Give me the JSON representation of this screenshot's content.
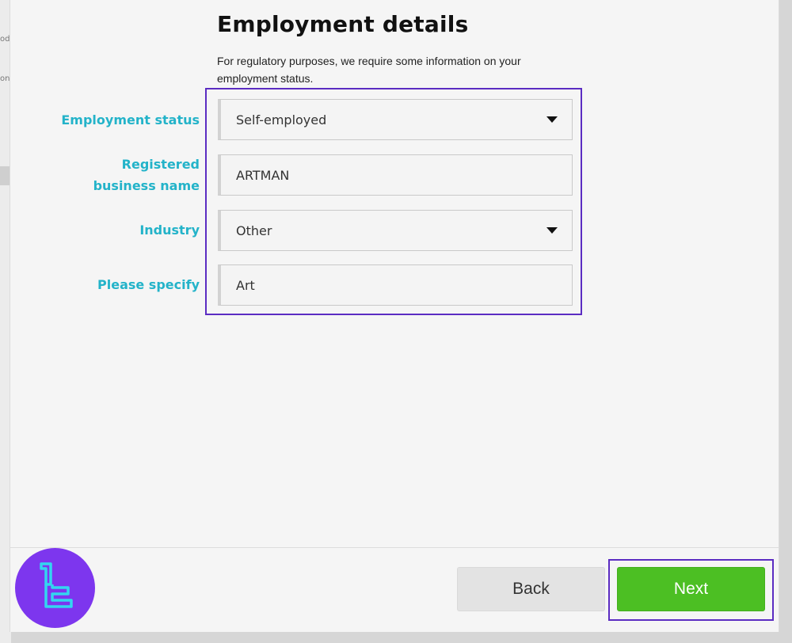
{
  "background": {
    "fragments": [
      "od",
      "onf"
    ]
  },
  "form": {
    "title": "Employment details",
    "subtitle": "For regulatory purposes, we require some information on your employment status.",
    "fields": [
      {
        "label": "Employment status",
        "type": "select",
        "value": "Self-employed"
      },
      {
        "label": "Registered business name",
        "type": "text",
        "value": "ARTMAN"
      },
      {
        "label": "Industry",
        "type": "select",
        "value": "Other"
      },
      {
        "label": "Please specify",
        "type": "text",
        "value": "Art"
      }
    ]
  },
  "footer": {
    "back_label": "Back",
    "next_label": "Next"
  },
  "colors": {
    "label": "#23b3c9",
    "next_button": "#4cbf23",
    "highlight": "#5b2cc2",
    "logo_badge": "#7d36ee"
  },
  "icons": {
    "dropdown": "caret-down-icon",
    "logo": "brand-logo-icon"
  }
}
